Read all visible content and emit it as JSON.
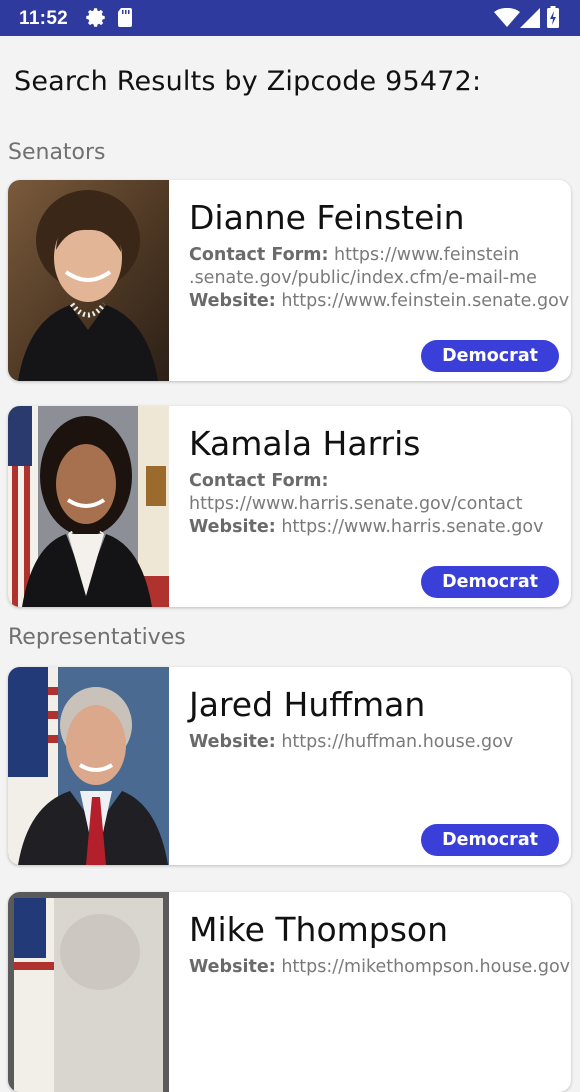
{
  "status_bar": {
    "time": "11:52",
    "icons": [
      "gear-icon",
      "sd-card-icon",
      "wifi-icon",
      "signal-icon",
      "battery-icon"
    ]
  },
  "page": {
    "title": "Search Results by Zipcode 95472:"
  },
  "sections": {
    "senators_label": "Senators",
    "representatives_label": "Representatives"
  },
  "officials": [
    {
      "name": "Dianne Feinstein",
      "contact_label": "Contact Form:",
      "contact_url_line1": "https://www.feinstein",
      "contact_url_line2": ".senate.gov/public/index.cfm/e-mail-me",
      "website_label": "Website:",
      "website_url": "https://www.feinstein.senate.gov",
      "party": "Democrat"
    },
    {
      "name": "Kamala Harris",
      "contact_label": "Contact Form:",
      "contact_url": "https://www.harris.senate.gov/contact",
      "website_label": "Website:",
      "website_url": "https://www.harris.senate.gov",
      "party": "Democrat"
    },
    {
      "name": "Jared Huffman",
      "website_label": "Website:",
      "website_url": "https://huffman.house.gov",
      "party": "Democrat"
    },
    {
      "name": "Mike Thompson",
      "website_label": "Website:",
      "website_url": "https://mikethompson.house.gov"
    }
  ],
  "colors": {
    "status_bar": "#2f3a9e",
    "party_badge": "#3b3fd9",
    "background": "#f3f3f3"
  }
}
